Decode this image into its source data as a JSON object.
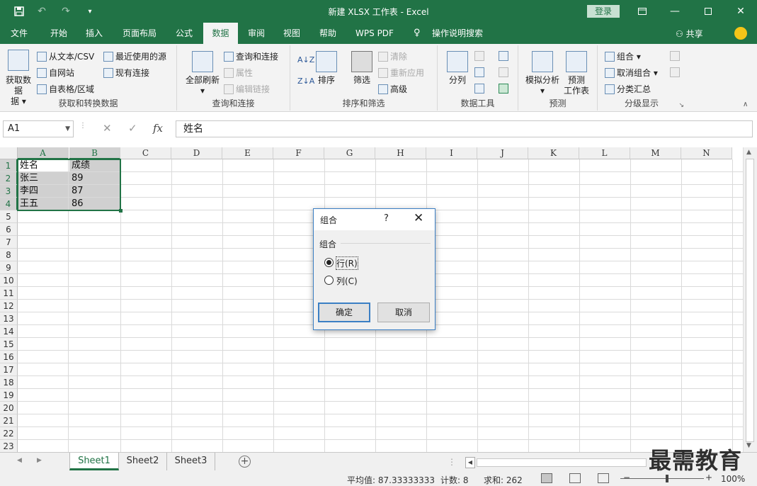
{
  "app": {
    "title": "新建 XLSX 工作表  -  Excel",
    "login_label": "登录",
    "accent_color": "#217346"
  },
  "menu": {
    "tabs": [
      "文件",
      "开始",
      "插入",
      "页面布局",
      "公式",
      "数据",
      "审阅",
      "视图",
      "帮助",
      "WPS PDF",
      "操作说明搜索"
    ],
    "active_tab": "数据",
    "share_label": "共享"
  },
  "ribbon": {
    "get_transform": {
      "label": "获取和转换数据",
      "get_data": "获取数据",
      "get_data_2": "据",
      "from_text": "从文本/CSV",
      "from_web": "自网站",
      "from_table": "自表格/区域",
      "recent_sources": "最近使用的源",
      "existing_conn": "现有连接"
    },
    "queries": {
      "label": "查询和连接",
      "refresh_all": "全部刷新",
      "queries_conn": "查询和连接",
      "properties": "属性",
      "edit_links": "编辑链接"
    },
    "sort_filter": {
      "label": "排序和筛选",
      "sort": "排序",
      "filter": "筛选",
      "clear": "清除",
      "reapply": "重新应用",
      "advanced": "高级"
    },
    "data_tools": {
      "label": "数据工具",
      "text_to_columns": "分列"
    },
    "forecast": {
      "label": "预测",
      "what_if": "模拟分析",
      "forecast_sheet_1": "预测",
      "forecast_sheet_2": "工作表"
    },
    "outline": {
      "label": "分级显示",
      "group": "组合",
      "ungroup": "取消组合",
      "subtotal": "分类汇总"
    }
  },
  "formula_bar": {
    "name_box": "A1",
    "fx_symbol": "fx",
    "content": "姓名"
  },
  "sheet": {
    "columns": [
      "A",
      "B",
      "C",
      "D",
      "E",
      "F",
      "G",
      "H",
      "I",
      "J",
      "K",
      "L",
      "M",
      "N"
    ],
    "rows": [
      "1",
      "2",
      "3",
      "4",
      "5",
      "6",
      "7",
      "8",
      "9",
      "10",
      "11",
      "12",
      "13",
      "14",
      "15",
      "16",
      "17",
      "18",
      "19",
      "20",
      "21",
      "22",
      "23"
    ],
    "cells": [
      [
        "姓名",
        "成绩"
      ],
      [
        "张三",
        "89"
      ],
      [
        "李四",
        "87"
      ],
      [
        "王五",
        "86"
      ]
    ]
  },
  "sheet_tabs": [
    "Sheet1",
    "Sheet2",
    "Sheet3"
  ],
  "status": {
    "average": "平均值: 87.33333333",
    "count": "计数: 8",
    "sum": "求和: 262",
    "zoom": "100%"
  },
  "watermark": "最需教育",
  "dialog": {
    "title": "组合",
    "help": "?",
    "group_label": "组合",
    "option_rows": "行(R)",
    "option_cols": "列(C)",
    "ok": "确定",
    "cancel": "取消",
    "selected": "rows"
  }
}
